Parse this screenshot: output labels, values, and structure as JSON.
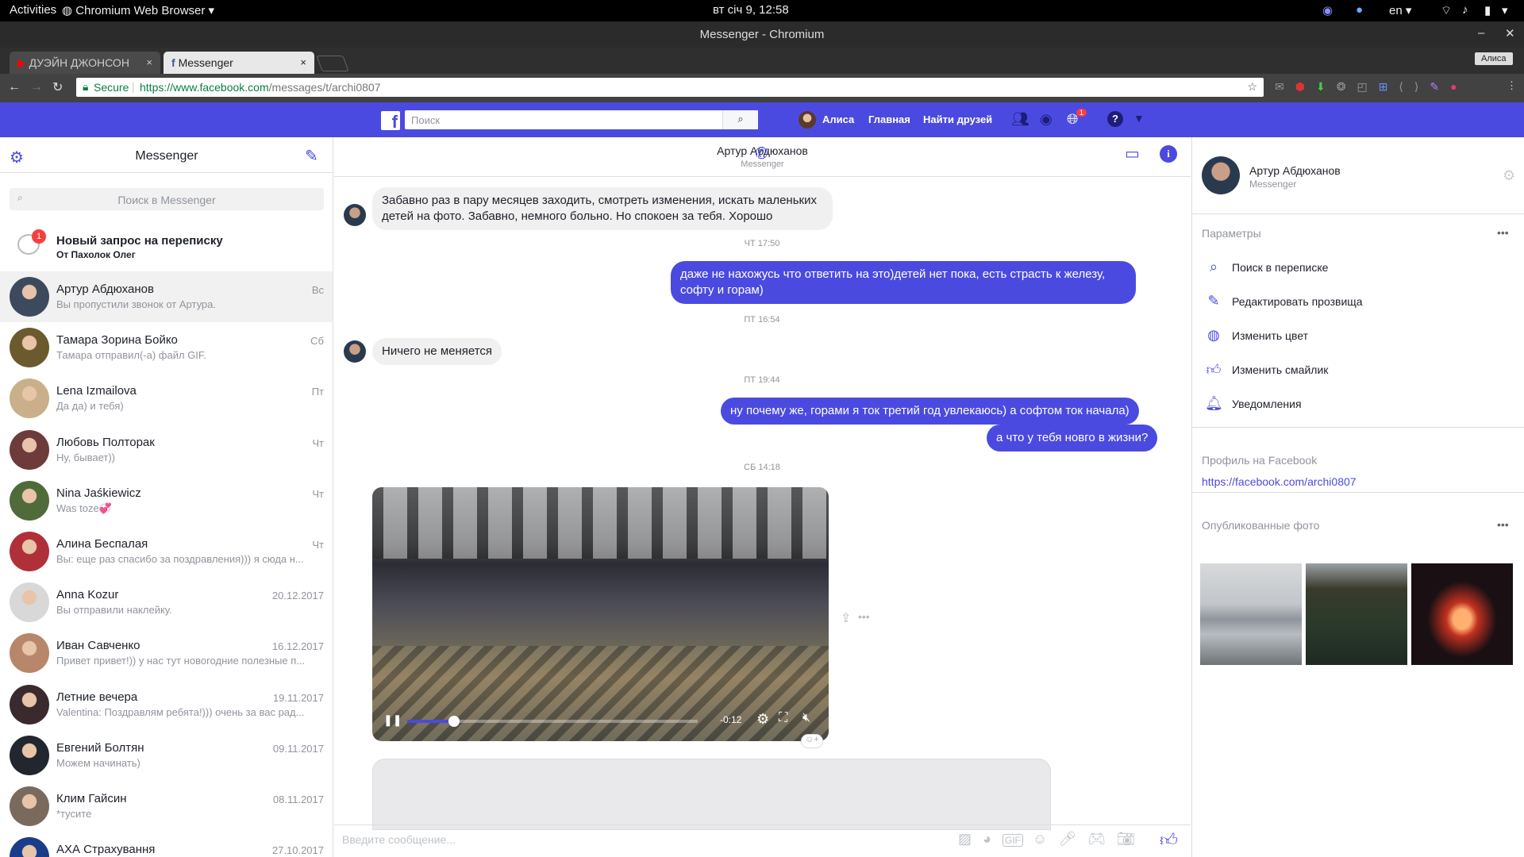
{
  "system_bar": {
    "activities": "Activities",
    "app_menu": "Chromium Web Browser",
    "clock": "вт січ  9, 12:58",
    "language": "en"
  },
  "window": {
    "title": "Messenger - Chromium",
    "profile": "Алиса"
  },
  "tabs": [
    {
      "label": "ДУЭЙН ДЖОНСОН",
      "close": "×"
    },
    {
      "label": "Messenger",
      "close": "×"
    }
  ],
  "address_bar": {
    "secure_label": "Secure",
    "url_host": "https://www.facebook.com",
    "url_path": "/messages/t/archi0807"
  },
  "facebook_bar": {
    "search_placeholder": "Поиск",
    "user_name": "Алиса",
    "home": "Главная",
    "find_friends": "Найти друзей",
    "notification_count": "1"
  },
  "sidebar": {
    "title": "Messenger",
    "search_placeholder": "Поиск в Messenger",
    "request": {
      "badge": "1",
      "title": "Новый запрос на переписку",
      "from": "От Пахолок Олег"
    },
    "conversations": [
      {
        "name": "Артур Абдюханов",
        "snippet": "Вы пропустили звонок от Артура.",
        "date": "Вс",
        "color": "#3d4a5e"
      },
      {
        "name": "Тамара Зорина Бойко",
        "snippet": "Тамара отправил(-а) файл GIF.",
        "date": "Сб",
        "color": "#6b5a2e"
      },
      {
        "name": "Lena Izmailova",
        "snippet": "Да да) и тебя)",
        "date": "Пт",
        "color": "#c9b08a"
      },
      {
        "name": "Любовь Полторак",
        "snippet": "Ну, бывает))",
        "date": "Чт",
        "color": "#6e3b3b"
      },
      {
        "name": "Nina Jaśkiewicz",
        "snippet": "Was toze💞",
        "date": "Чт",
        "color": "#4f6b3a"
      },
      {
        "name": "Алина Беспалая",
        "snippet": "Вы: еще раз спасибо за поздравления))) я сюда н...",
        "date": "Чт",
        "color": "#b0303a"
      },
      {
        "name": "Anna Kozur",
        "snippet": "Вы отправили наклейку.",
        "date": "20.12.2017",
        "color": "#d8d8d8"
      },
      {
        "name": "Иван Савченко",
        "snippet": "Привет привет!)) у нас тут новогодние полезные п...",
        "date": "16.12.2017",
        "color": "#b8866a"
      },
      {
        "name": "Летние вечера",
        "snippet": "Valentina: Поздравлям ребята!))) очень за вас рад...",
        "date": "19.11.2017",
        "color": "#3a2a2e"
      },
      {
        "name": "Евгений Болтян",
        "snippet": "Можем начинать)",
        "date": "09.11.2017",
        "color": "#22262e"
      },
      {
        "name": "Клим Гайсин",
        "snippet": "*тусите",
        "date": "08.11.2017",
        "color": "#7a6a5e"
      },
      {
        "name": "АХА Страхування",
        "snippet": "",
        "date": "27.10.2017",
        "color": "#1a3c8a"
      }
    ]
  },
  "chat": {
    "contact_name": "Артур Абдюханов",
    "contact_sub": "Messenger",
    "messages": {
      "m1": "Забавно раз в пару месяцев заходить, смотреть изменения, искать маленьких детей на фото. Забавно, немного больно. Но спокоен за тебя. Хорошо",
      "t1": "ЧТ 17:50",
      "m2": "даже не нахожусь что ответить на это)детей нет пока, есть страсть к железу, софту и горам)",
      "t2": "ПТ 16:54",
      "m3": "Ничего не меняется",
      "t3": "ПТ 19:44",
      "m4": "ну почему же, горами я ток третий год увлекаюсь) а софтом ток начала)",
      "m5": "а что у тебя новго в жизни?",
      "t4": "СБ 14:18"
    },
    "video": {
      "time_left": "-0:12",
      "progress": 0.16
    },
    "composer_placeholder": "Введите сообщение..."
  },
  "details": {
    "name": "Артур Абдюханов",
    "sub": "Messenger",
    "params_title": "Параметры",
    "options": [
      {
        "label": "Поиск в переписке",
        "icon": "search-icon"
      },
      {
        "label": "Редактировать прозвища",
        "icon": "pencil-icon"
      },
      {
        "label": "Изменить цвет",
        "icon": "palette-icon"
      },
      {
        "label": "Изменить смайлик",
        "icon": "thumbs-up-icon"
      },
      {
        "label": "Уведомления",
        "icon": "bell-icon"
      }
    ],
    "profile_title": "Профиль на Facebook",
    "profile_link": "https://facebook.com/archi0807",
    "photos_title": "Опубликованные фото"
  },
  "colors": {
    "accent": "#4b4ae0",
    "fb_bar": "#4b4ae0"
  }
}
